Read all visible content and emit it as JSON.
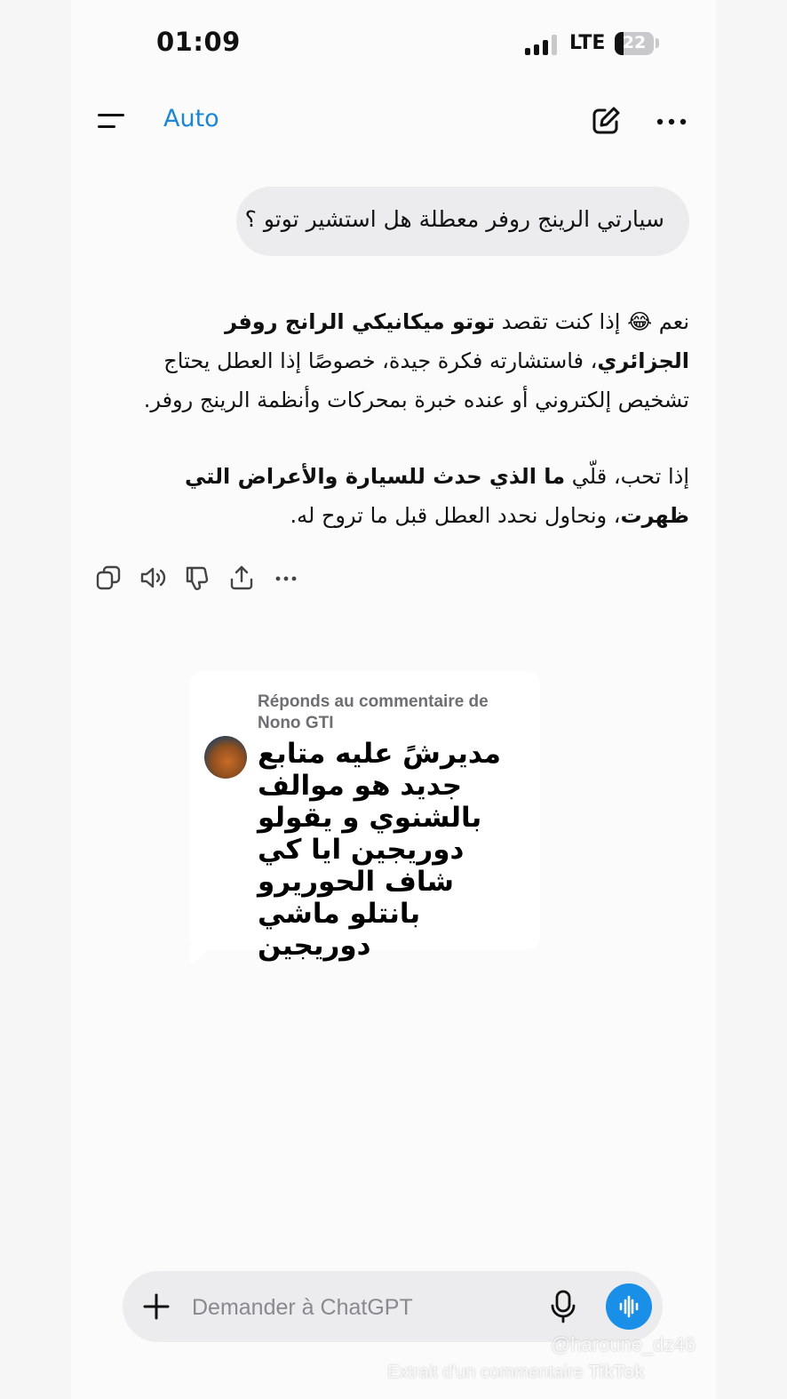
{
  "status_bar": {
    "time": "01:09",
    "network": "LTE",
    "battery": "22",
    "battery_level": 0.22
  },
  "header": {
    "model": "Auto",
    "icons": [
      "menu-icon",
      "new-chat-icon",
      "more-icon"
    ]
  },
  "conversation": {
    "user_message": "سيارتي الرينج روفر معطلة هل استشير توتو ؟",
    "assistant": {
      "p1_start": "نعم 😂 إذا كنت تقصد ",
      "p1_bold": "توتو ميكانيكي الرانج روفر الجزائري",
      "p1_end": "، فاستشارته فكرة جيدة، خصوصًا إذا العطل يحتاج تشخيص إلكتروني أو عنده خبرة بمحركات وأنظمة الرينج روفر.",
      "p2_start": "إذا تحب، قلّي ",
      "p2_bold": "ما الذي حدث للسيارة والأعراض التي ظهرت",
      "p2_end": "، ونحاول نحدد العطل قبل ما تروح له."
    },
    "actions": [
      "copy-icon",
      "read-aloud-icon",
      "thumbs-down-icon",
      "share-icon",
      "more-icon"
    ]
  },
  "comment_overlay": {
    "reply_to": "Réponds au commentaire de Nono GTI",
    "text": "مديرشً عليه متابع جديد هو موالف بالشنوي و يقولو دوريجين ايا كي شاف الحوريرو بانتلو ماشي دوريجين"
  },
  "composer": {
    "placeholder": "Demander à ChatGPT",
    "icons": [
      "plus-icon",
      "microphone-icon",
      "voice-mode-icon"
    ],
    "accent": "#1a8fe8"
  },
  "watermark": {
    "user": "@haroune_dz46",
    "caption": "Extrait d'un commentaire",
    "brand": "TikTok"
  }
}
